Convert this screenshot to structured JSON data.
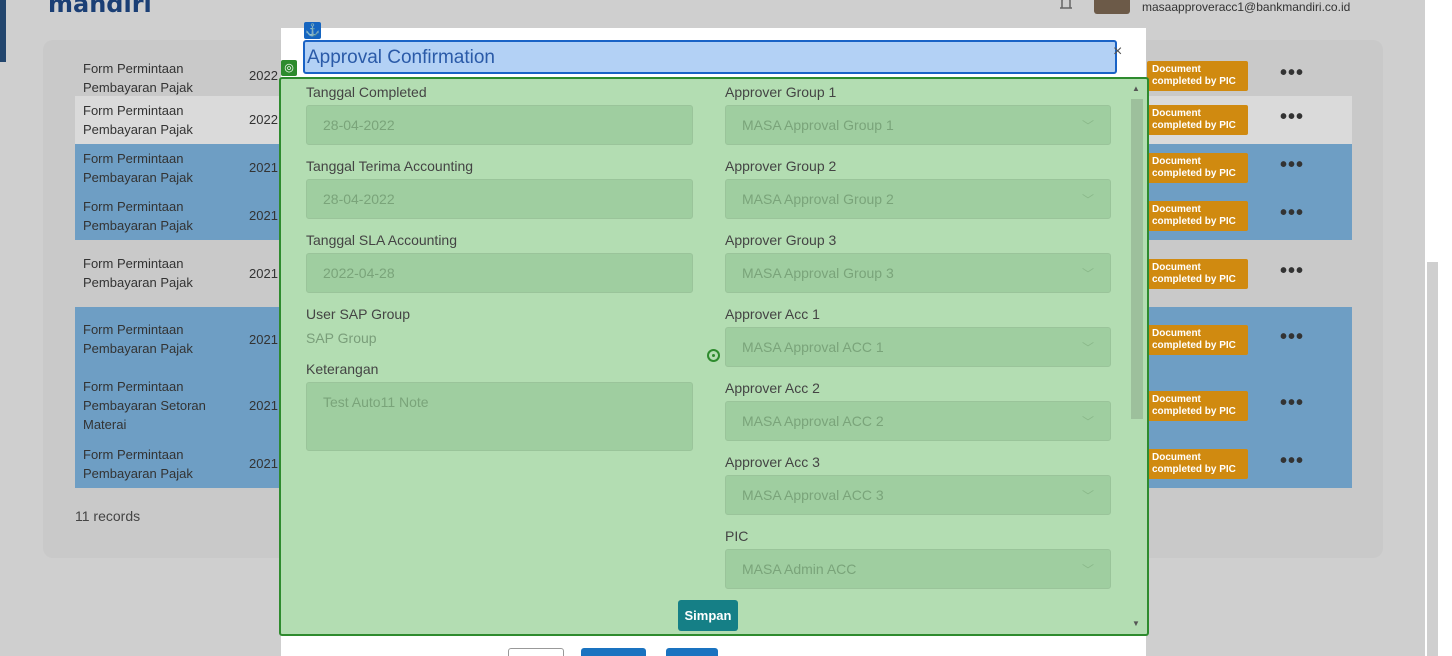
{
  "header": {
    "logo": "mandiri",
    "user_email": "masaapproveracc1@bankmandiri.co.id"
  },
  "table": {
    "rows": [
      {
        "doc": "Form Permintaan Pembayaran Pajak",
        "year": "2022",
        "status": "Document completed by PIC"
      },
      {
        "doc": "Form Permintaan Pembayaran Pajak",
        "year": "2022",
        "status": "Document completed by PIC"
      },
      {
        "doc": "Form Permintaan Pembayaran Pajak",
        "year": "2021",
        "status": "Document completed by PIC"
      },
      {
        "doc": "Form Permintaan Pembayaran Pajak",
        "year": "2021",
        "status": "Document completed by PIC"
      },
      {
        "doc": "Form Permintaan Pembayaran Pajak",
        "year": "2021",
        "status": "Document completed by PIC"
      },
      {
        "doc": "Form Permintaan Pembayaran Pajak",
        "year": "2021",
        "status": "Document completed by PIC"
      },
      {
        "doc": "Form Permintaan Pembayaran Setoran Materai",
        "year": "2021",
        "status": "Document completed by PIC"
      },
      {
        "doc": "Form Permintaan Pembayaran Pajak",
        "year": "2021",
        "status": "Document completed by PIC"
      }
    ],
    "more_label": "•••",
    "records": "11 records"
  },
  "modal": {
    "title": "Approval Confirmation",
    "close": "×",
    "left": {
      "tanggal_completed_label": "Tanggal Completed",
      "tanggal_completed_value": "28-04-2022",
      "tanggal_terima_label": "Tanggal Terima Accounting",
      "tanggal_terima_value": "28-04-2022",
      "tanggal_sla_label": "Tanggal SLA Accounting",
      "tanggal_sla_value": "2022-04-28",
      "user_sap_label": "User SAP Group",
      "user_sap_value": "SAP Group",
      "keterangan_label": "Keterangan",
      "keterangan_value": "Test Auto11 Note"
    },
    "right": {
      "g1_label": "Approver Group 1",
      "g1_value": "MASA Approval Group 1",
      "g2_label": "Approver Group 2",
      "g2_value": "MASA Approval Group 2",
      "g3_label": "Approver Group 3",
      "g3_value": "MASA Approval Group 3",
      "a1_label": "Approver Acc 1",
      "a1_value": "MASA Approval ACC 1",
      "a2_label": "Approver Acc 2",
      "a2_value": "MASA Approval ACC 2",
      "a3_label": "Approver Acc 3",
      "a3_value": "MASA Approval ACC 3",
      "pic_label": "PIC",
      "pic_value": "MASA Admin ACC"
    },
    "submit": "Simpan"
  }
}
